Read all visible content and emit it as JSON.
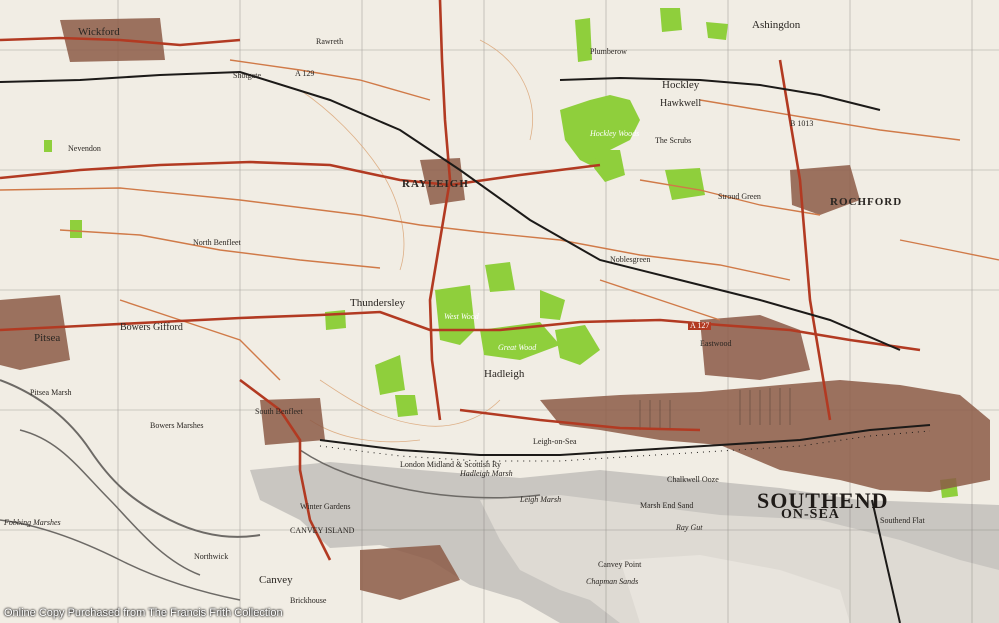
{
  "credit": "Online Copy Purchased from The Francis Frith Collection",
  "colors": {
    "paper": "#f1ede4",
    "sea": "#c9c6c1",
    "mud": "#dedad3",
    "woodland": "#8fcf3c",
    "road_main": "#b23a22",
    "road_minor": "#d07a48",
    "railway": "#1c1a18",
    "urban": "#8c5a47",
    "grid": "#6d6a66",
    "contour": "#d9a06f"
  },
  "labels": {
    "southend": "SOUTHEND",
    "on_sea": "ON-SEA",
    "rayleigh": "RAYLEIGH",
    "rochford": "ROCHFORD",
    "hockley": "Hockley",
    "hawkwell": "Hawkwell",
    "ashingdon": "Ashingdon",
    "wickford": "Wickford",
    "shotgate": "Shotgate",
    "rawreth": "Rawreth",
    "nevendon": "Nevendon",
    "pitsea": "Pitsea",
    "bowers_gifford": "Bowers Gifford",
    "thundersley": "Thundersley",
    "north_benfleet": "North Benfleet",
    "south_benfleet": "South Benfleet",
    "hadleigh": "Hadleigh",
    "leigh_on_sea": "Leigh-on-Sea",
    "canvey_island": "CANVEY ISLAND",
    "canvey": "Canvey",
    "great_wood": "Great Wood",
    "west_wood": "West Wood",
    "hockley_woods": "Hockley Woods",
    "eastwood": "Eastwood",
    "noblesgreen": "Noblesgreen",
    "stroud_green": "Stroud Green",
    "the_scrubs": "The Scrubs",
    "railway_name": "London Midland & Scottish Ry",
    "hadleigh_marsh": "Hadleigh Marsh",
    "leigh_marsh": "Leigh Marsh",
    "marsh_end_sand": "Marsh End Sand",
    "ray_gut": "Ray Gut",
    "chapman_sands": "Chapman Sands",
    "canvey_point": "Canvey Point",
    "chalkwell_ooze": "Chalkwell Ooze",
    "southend_flat": "Southend Flat",
    "bowers_marshes": "Bowers Marshes",
    "pitsea_marsh": "Pitsea Marsh",
    "fobbing_marshes": "Fobbing Marshes",
    "winter_gardens": "Winter Gardens",
    "northwick": "Northwick",
    "brickhouse": "Brickhouse",
    "plumberow": "Plumberow",
    "a127": "A 127",
    "a129": "A 129",
    "b1013": "B 1013"
  }
}
